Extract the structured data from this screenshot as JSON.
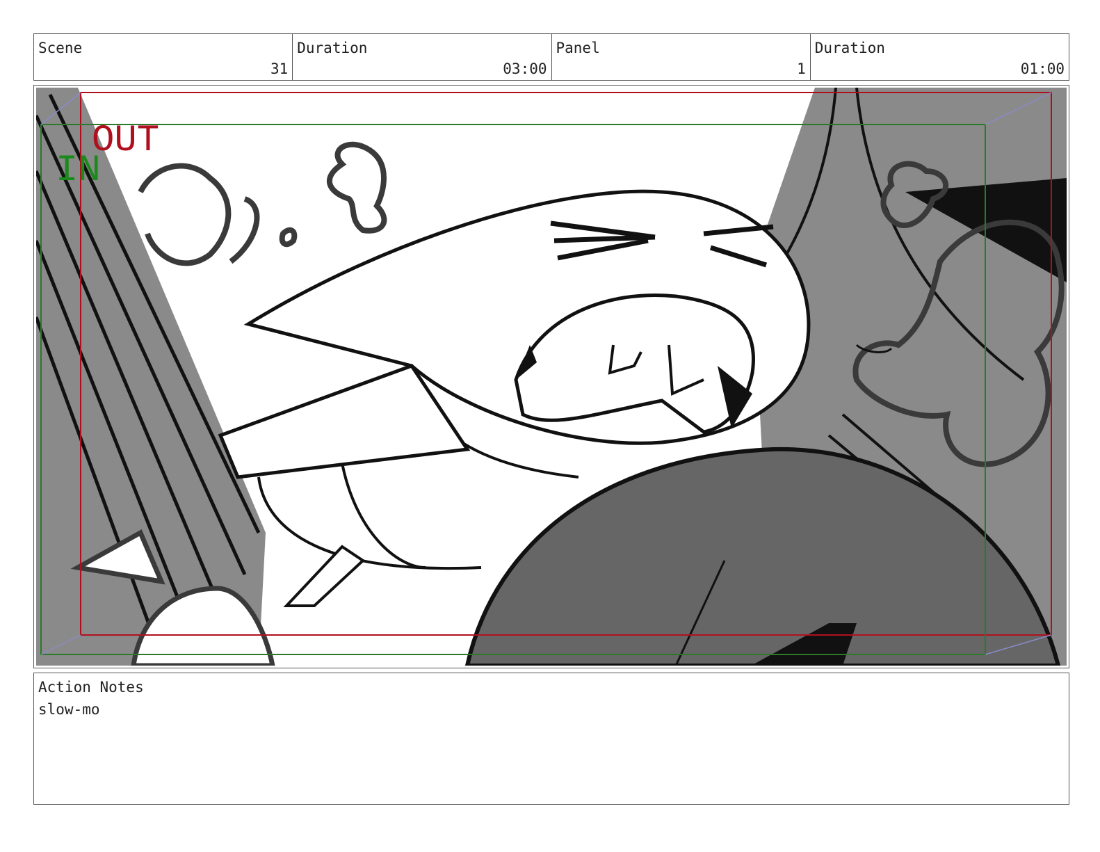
{
  "header": {
    "scene": {
      "label": "Scene",
      "value": "31"
    },
    "scene_duration": {
      "label": "Duration",
      "value": "03:00"
    },
    "panel": {
      "label": "Panel",
      "value": "1"
    },
    "panel_duration": {
      "label": "Duration",
      "value": "01:00"
    }
  },
  "frame": {
    "out_label": "OUT",
    "in_label": "IN",
    "out_color": "#b0101e",
    "in_color": "#1a8a1a"
  },
  "notes": {
    "label": "Action Notes",
    "text": "slow-mo"
  }
}
